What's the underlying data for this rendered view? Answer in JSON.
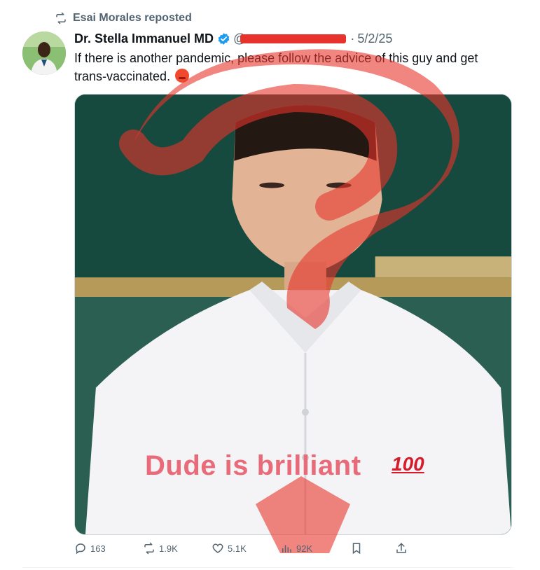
{
  "repost": {
    "label": "Esai Morales reposted",
    "icon": "repost-icon"
  },
  "author": {
    "name": "Dr. Stella Immanuel MD",
    "handle": "@",
    "separator": "·",
    "date": "5/2/25"
  },
  "tweet": {
    "text": "If there is another pandemic, please follow the advice of this guy and get trans-vaccinated."
  },
  "media": {
    "caption": "Dude is brilliant",
    "badge": "100"
  },
  "actions": {
    "replies": "163",
    "reposts": "1.9K",
    "likes": "5.1K",
    "views": "92K"
  },
  "colors": {
    "accent": "#1d9bf0",
    "overlay": "#e8332c",
    "muted": "#536471"
  }
}
